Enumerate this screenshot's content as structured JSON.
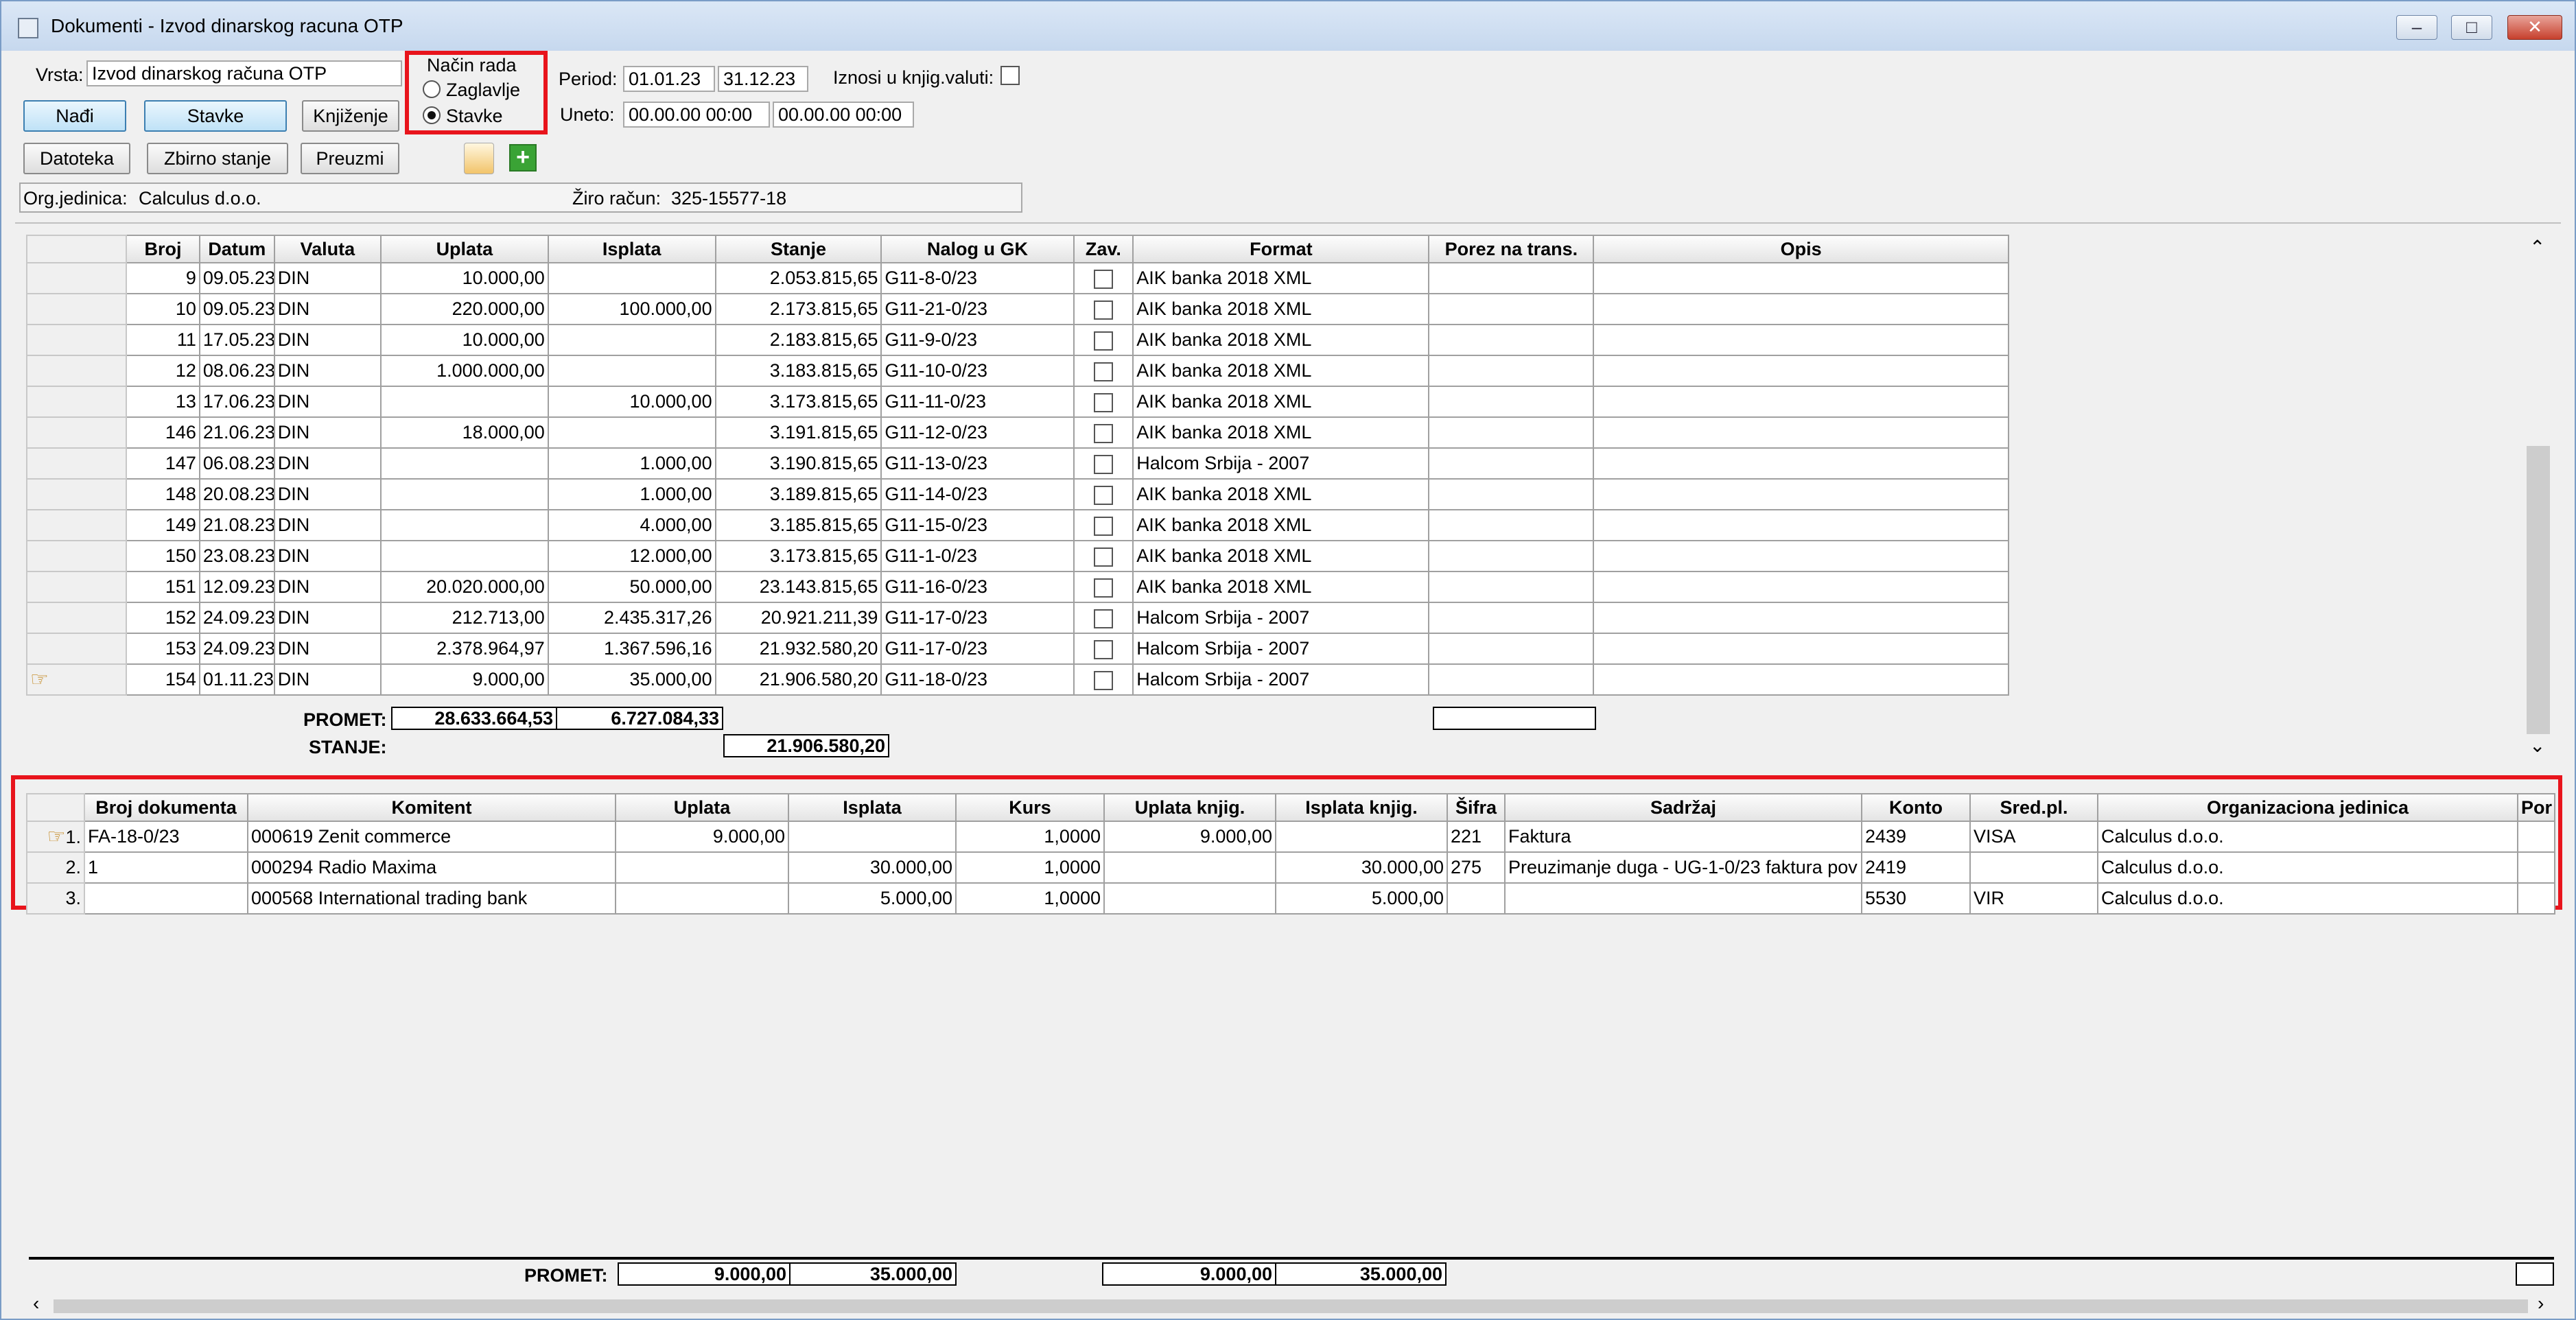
{
  "window": {
    "title": "Dokumenti - Izvod dinarskog racuna OTP"
  },
  "toolbar": {
    "vrsta_label": "Vrsta:",
    "vrsta_value": "Izvod dinarskog računa OTP",
    "nacin_rada_label": "Način rada",
    "radio_zaglavlje": "Zaglavlje",
    "radio_stavke": "Stavke",
    "selected_mode": "Stavke",
    "period_label": "Period:",
    "period_from": "01.01.23",
    "period_to": "31.12.23",
    "iznosi_label": "Iznosi u knjig.valuti:",
    "uneto_label": "Uneto:",
    "uneto_from": "00.00.00 00:00",
    "uneto_to": "00.00.00 00:00",
    "btn_nadji": "Nađi",
    "btn_stavke": "Stavke",
    "btn_knjizenje": "Knjiženje",
    "btn_datoteka": "Datoteka",
    "btn_zbirno": "Zbirno stanje",
    "btn_preuzmi": "Preuzmi"
  },
  "info": {
    "org_label": "Org.jedinica:",
    "org_value": "Calculus d.o.o.",
    "ziro_label": "Žiro račun:",
    "ziro_value": "325-15577-18"
  },
  "main_table": {
    "columns": [
      "Broj",
      "Datum",
      "Valuta",
      "Uplata",
      "Isplata",
      "Stanje",
      "Nalog u GK",
      "Zav.",
      "Format",
      "Porez na trans.",
      "Opis"
    ],
    "rows": [
      [
        "9",
        "09.05.23",
        "DIN",
        "10.000,00",
        "",
        "2.053.815,65",
        "G11-8-0/23",
        "",
        "AIK banka 2018 XML",
        "",
        ""
      ],
      [
        "10",
        "09.05.23",
        "DIN",
        "220.000,00",
        "100.000,00",
        "2.173.815,65",
        "G11-21-0/23",
        "",
        "AIK banka 2018 XML",
        "",
        ""
      ],
      [
        "11",
        "17.05.23",
        "DIN",
        "10.000,00",
        "",
        "2.183.815,65",
        "G11-9-0/23",
        "",
        "AIK banka 2018 XML",
        "",
        ""
      ],
      [
        "12",
        "08.06.23",
        "DIN",
        "1.000.000,00",
        "",
        "3.183.815,65",
        "G11-10-0/23",
        "",
        "AIK banka 2018 XML",
        "",
        ""
      ],
      [
        "13",
        "17.06.23",
        "DIN",
        "",
        "10.000,00",
        "3.173.815,65",
        "G11-11-0/23",
        "",
        "AIK banka 2018 XML",
        "",
        ""
      ],
      [
        "146",
        "21.06.23",
        "DIN",
        "18.000,00",
        "",
        "3.191.815,65",
        "G11-12-0/23",
        "",
        "AIK banka 2018 XML",
        "",
        ""
      ],
      [
        "147",
        "06.08.23",
        "DIN",
        "",
        "1.000,00",
        "3.190.815,65",
        "G11-13-0/23",
        "",
        "Halcom Srbija - 2007",
        "",
        ""
      ],
      [
        "148",
        "20.08.23",
        "DIN",
        "",
        "1.000,00",
        "3.189.815,65",
        "G11-14-0/23",
        "",
        "AIK banka 2018 XML",
        "",
        ""
      ],
      [
        "149",
        "21.08.23",
        "DIN",
        "",
        "4.000,00",
        "3.185.815,65",
        "G11-15-0/23",
        "",
        "AIK banka 2018 XML",
        "",
        ""
      ],
      [
        "150",
        "23.08.23",
        "DIN",
        "",
        "12.000,00",
        "3.173.815,65",
        "G11-1-0/23",
        "",
        "AIK banka 2018 XML",
        "",
        ""
      ],
      [
        "151",
        "12.09.23",
        "DIN",
        "20.020.000,00",
        "50.000,00",
        "23.143.815,65",
        "G11-16-0/23",
        "",
        "AIK banka 2018 XML",
        "",
        ""
      ],
      [
        "152",
        "24.09.23",
        "DIN",
        "212.713,00",
        "2.435.317,26",
        "20.921.211,39",
        "G11-17-0/23",
        "",
        "Halcom Srbija - 2007",
        "",
        ""
      ],
      [
        "153",
        "24.09.23",
        "DIN",
        "2.378.964,97",
        "1.367.596,16",
        "21.932.580,20",
        "G11-17-0/23",
        "",
        "Halcom Srbija - 2007",
        "",
        ""
      ],
      [
        "154",
        "01.11.23",
        "DIN",
        "9.000,00",
        "35.000,00",
        "21.906.580,20",
        "G11-18-0/23",
        "",
        "Halcom Srbija - 2007",
        "",
        ""
      ]
    ],
    "promet_label": "PROMET:",
    "promet_uplata": "28.633.664,53",
    "promet_isplata": "6.727.084,33",
    "stanje_label": "STANJE:",
    "stanje_value": "21.906.580,20"
  },
  "detail_table": {
    "columns": [
      "Broj dokumenta",
      "Komitent",
      "Uplata",
      "Isplata",
      "Kurs",
      "Uplata knjig.",
      "Isplata knjig.",
      "Šifra",
      "Sadržaj",
      "Konto",
      "Sred.pl.",
      "Organizaciona jedinica",
      "Por"
    ],
    "rows": [
      {
        "idx": "1.",
        "cells": [
          "FA-18-0/23",
          "000619 Zenit commerce",
          "9.000,00",
          "",
          "1,0000",
          "9.000,00",
          "",
          "221",
          "Faktura",
          "2439",
          "VISA",
          "Calculus d.o.o.",
          ""
        ]
      },
      {
        "idx": "2.",
        "cells": [
          "1",
          "000294 Radio Maxima",
          "",
          "30.000,00",
          "1,0000",
          "",
          "30.000,00",
          "275",
          "Preuzimanje duga - UG-1-0/23 faktura pov",
          "2419",
          "",
          "Calculus d.o.o.",
          ""
        ]
      },
      {
        "idx": "3.",
        "cells": [
          "",
          "000568 International trading bank",
          "",
          "5.000,00",
          "1,0000",
          "",
          "5.000,00",
          "",
          "",
          "5530",
          "VIR",
          "Calculus d.o.o.",
          ""
        ]
      }
    ],
    "promet_label": "PROMET:",
    "promet_uplata": "9.000,00",
    "promet_isplata": "35.000,00",
    "promet_uplata_knjig": "9.000,00",
    "promet_isplata_knjig": "35.000,00"
  },
  "colors": {
    "highlight": "#e8141c",
    "selected_button": "#3c7fb1"
  }
}
